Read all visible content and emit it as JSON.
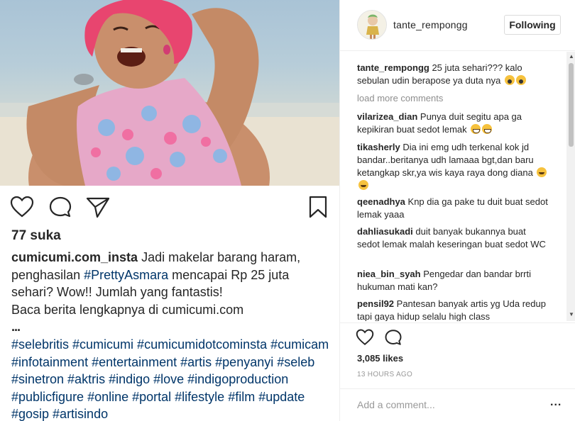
{
  "post": {
    "likes_label": "77 suka",
    "caption": {
      "username": "cumicumi.com_insta",
      "text_part1": " Jadi makelar barang haram, penghasilan ",
      "hashtag_inline": "#PrettyAsmara",
      "text_part2": " mencapai Rp 25 juta sehari? Wow!! Jumlah yang fantastis!",
      "line_read": "Baca berita lengkapnya di cumicumi.com",
      "dots": "...",
      "hashtags": "#selebritis #cumicumi #cumicumidotcominsta #cumicam #infotainment #entertainment #artis #penyanyi #seleb #sinetron #aktris #indigo #love #indigoproduction #publicfigure #online #portal #lifestyle #film #update #gosip #artisindo"
    }
  },
  "side": {
    "header": {
      "username": "tante_rempongg",
      "follow_label": "Following"
    },
    "author_comment": {
      "user": "tante_rempongg",
      "text": " 25 juta sehari??? kalo sebulan udin berapose ya duta nya "
    },
    "load_more": "load more comments",
    "comments": [
      {
        "user": "vilarizea_dian",
        "text": " Punya duit segitu apa ga kepikiran buat sedot lemak "
      },
      {
        "user": "tikasherly",
        "text": " Dia ini emg udh terkenal kok jd bandar..beritanya udh lamaaa bgt,dan baru ketangkap skr,ya wis kaya raya dong diana "
      },
      {
        "user": "qeenadhya",
        "text": " Knp dia ga pake tu duit buat sedot lemak yaaa"
      },
      {
        "user": "dahliasukadi",
        "text": " duit banyak bukannya buat sedot lemak malah keseringan buat sedot WC"
      },
      {
        "user": "niea_bin_syah",
        "text": " Pengedar dan bandar brrti hukuman mati kan?"
      },
      {
        "user": "pensil92",
        "text": " Pantesan banyak artis yg Uda redup tapi gaya hidup selalu high class"
      }
    ],
    "likes_label": "3,085 likes",
    "time_label": "13 HOURS AGO",
    "add_comment_placeholder": "Add a comment...",
    "more_label": "..."
  },
  "colors": {
    "hashtag": "#003569",
    "muted": "#999999",
    "text": "#262626"
  },
  "icons": [
    "heart-icon",
    "comment-icon",
    "share-icon",
    "bookmark-icon",
    "more-icon"
  ]
}
